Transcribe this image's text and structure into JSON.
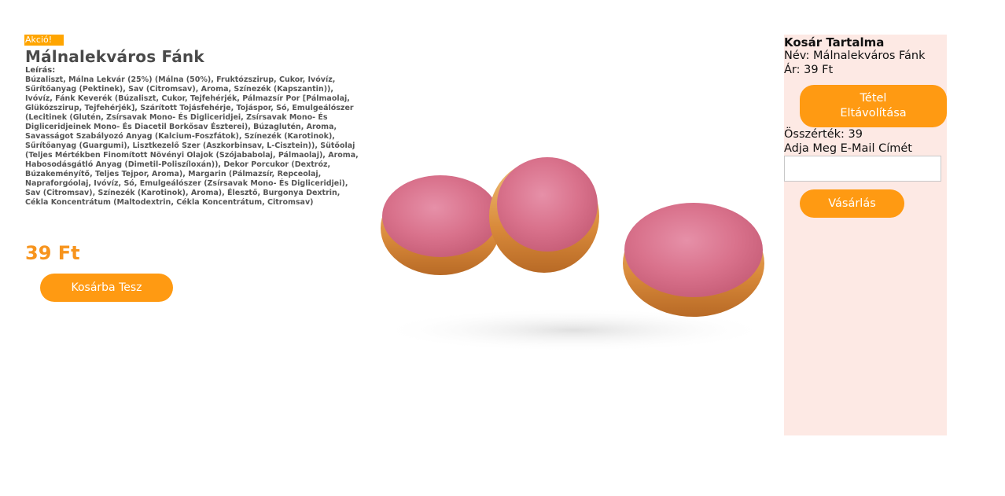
{
  "product": {
    "badge": "Akció!",
    "title": "Málnalekváros Fánk",
    "description_label": "Leírás:",
    "description": "Búzaliszt, Málna Lekvár (25%) (Málna (50%), Fruktózszirup, Cukor, Ivóvíz, Sűrítőanyag (Pektinek), Sav (Citromsav), Aroma, Színezék (Kapszantin)), Ivóvíz, Fánk Keverék (Búzaliszt, Cukor, Tejfehérjék, Pálmazsír Por [Pálmaolaj, Glükózszirup, Tejfehérjék], Szárított Tojásfehérje, Tojáspor, Só, Emulgeálószer (Lecitinek (Glutén, Zsírsavak Mono- És Digliceridjei, Zsírsavak Mono- És Digliceridjeinek Mono- És Diacetil Borkősav Észterei), Búzaglutén, Aroma, Savasságot Szabályozó Anyag (Kalcium-Foszfátok), Színezék (Karotinok), Sűrítőanyag (Guargumi), Lisztkezelő Szer (Aszkorbinsav, L-Cisztein)), Sütőolaj (Teljes Mértékben Finomított Növényi Olajok (Szójababolaj, Pálmaolaj), Aroma, Habosodásgátló Anyag (Dimetil-Poliszíloxán)), Dekor Porcukor (Dextróz, Búzakeményítő, Teljes Tejpor, Aroma), Margarin (Pálmazsír, Repceolaj, Napraforgóolaj, Ivóvíz, Só, Emulgeálószer (Zsírsavak Mono- És Digliceridjei), Sav (Citromsav), Színezék (Karotinok), Aroma), Élesztő, Burgonya Dextrin, Cékla Koncentrátum (Maltodextrin, Cékla Koncentrátum, Citromsav)",
    "price": "39 Ft",
    "add_to_cart_label": "Kosárba Tesz",
    "image_alt": "Málnalekváros Fánk"
  },
  "cart": {
    "title": "Kosár Tartalma",
    "item_name": "Név: Málnalekváros Fánk",
    "item_price": "Ár: 39 Ft",
    "remove_label_line1": "Tétel",
    "remove_label_line2": "Eltávolítása",
    "total": "Összérték: 39",
    "email_prompt": "Adja Meg E-Mail Címét",
    "email_value": "",
    "buy_label": "Vásárlás"
  },
  "colors": {
    "accent": "#ff9a12",
    "price": "#f7941d",
    "badge": "#ffa500",
    "cart_background": "#fde9e4",
    "donut_glaze": "#d9728c"
  }
}
